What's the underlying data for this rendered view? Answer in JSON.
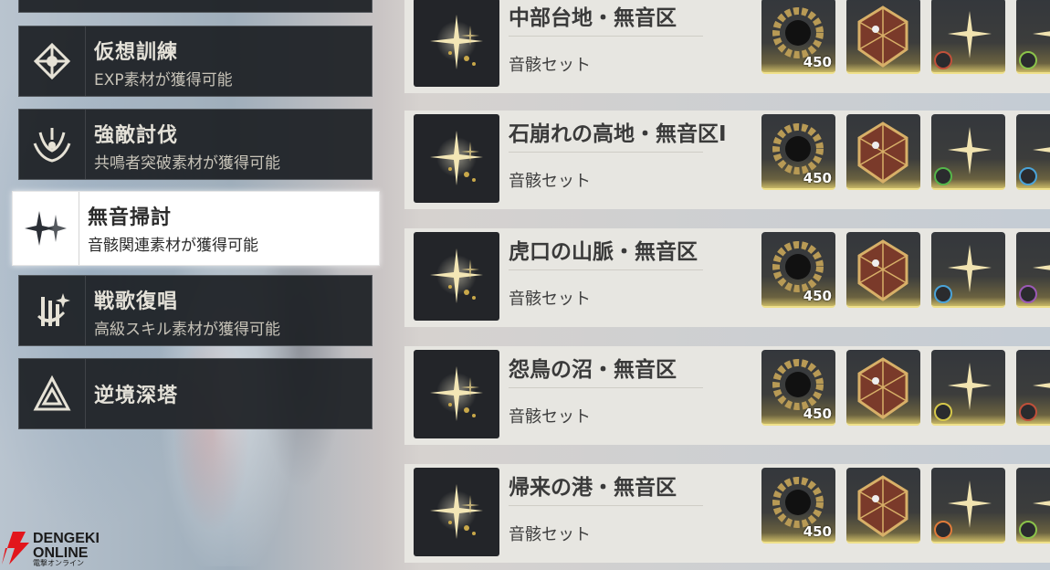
{
  "menu": [
    {
      "title": "仮想訓練",
      "subtitle": "EXP素材が獲得可能",
      "icon": "virtual-training-icon",
      "active": false
    },
    {
      "title": "強敵討伐",
      "subtitle": "共鳴者突破素材が獲得可能",
      "icon": "boss-challenge-icon",
      "active": false
    },
    {
      "title": "無音掃討",
      "subtitle": "音骸関連素材が獲得可能",
      "icon": "tacet-field-icon",
      "active": true
    },
    {
      "title": "戦歌復唱",
      "subtitle": "高級スキル素材が獲得可能",
      "icon": "weekly-challenge-icon",
      "active": false
    },
    {
      "title": "逆境深塔",
      "subtitle": "",
      "icon": "tower-of-adversity-icon",
      "active": false
    }
  ],
  "locations": [
    {
      "name": "中部台地・無音区",
      "set": "音骸セット",
      "qty": "450",
      "badges": [
        "#c0503a",
        "#8bc34a"
      ]
    },
    {
      "name": "石崩れの高地・無音区Ⅰ",
      "set": "音骸セット",
      "qty": "450",
      "badges": [
        "#55b64a",
        "#4aa3d8"
      ]
    },
    {
      "name": "虎口の山脈・無音区",
      "set": "音骸セット",
      "qty": "450",
      "badges": [
        "#4aa3d8",
        "#9b59b6"
      ]
    },
    {
      "name": "怨鳥の沼・無音区",
      "set": "音骸セット",
      "qty": "450",
      "badges": [
        "#d6c84a",
        "#c0503a"
      ]
    },
    {
      "name": "帰来の港・無音区",
      "set": "音骸セット",
      "qty": "450",
      "badges": [
        "#e07b3a",
        "#8bc34a"
      ]
    }
  ],
  "watermark": {
    "line1": "DENGEKI",
    "line2": "ONLINE",
    "line3": "電撃オンライン",
    "color": "#e2161c"
  }
}
